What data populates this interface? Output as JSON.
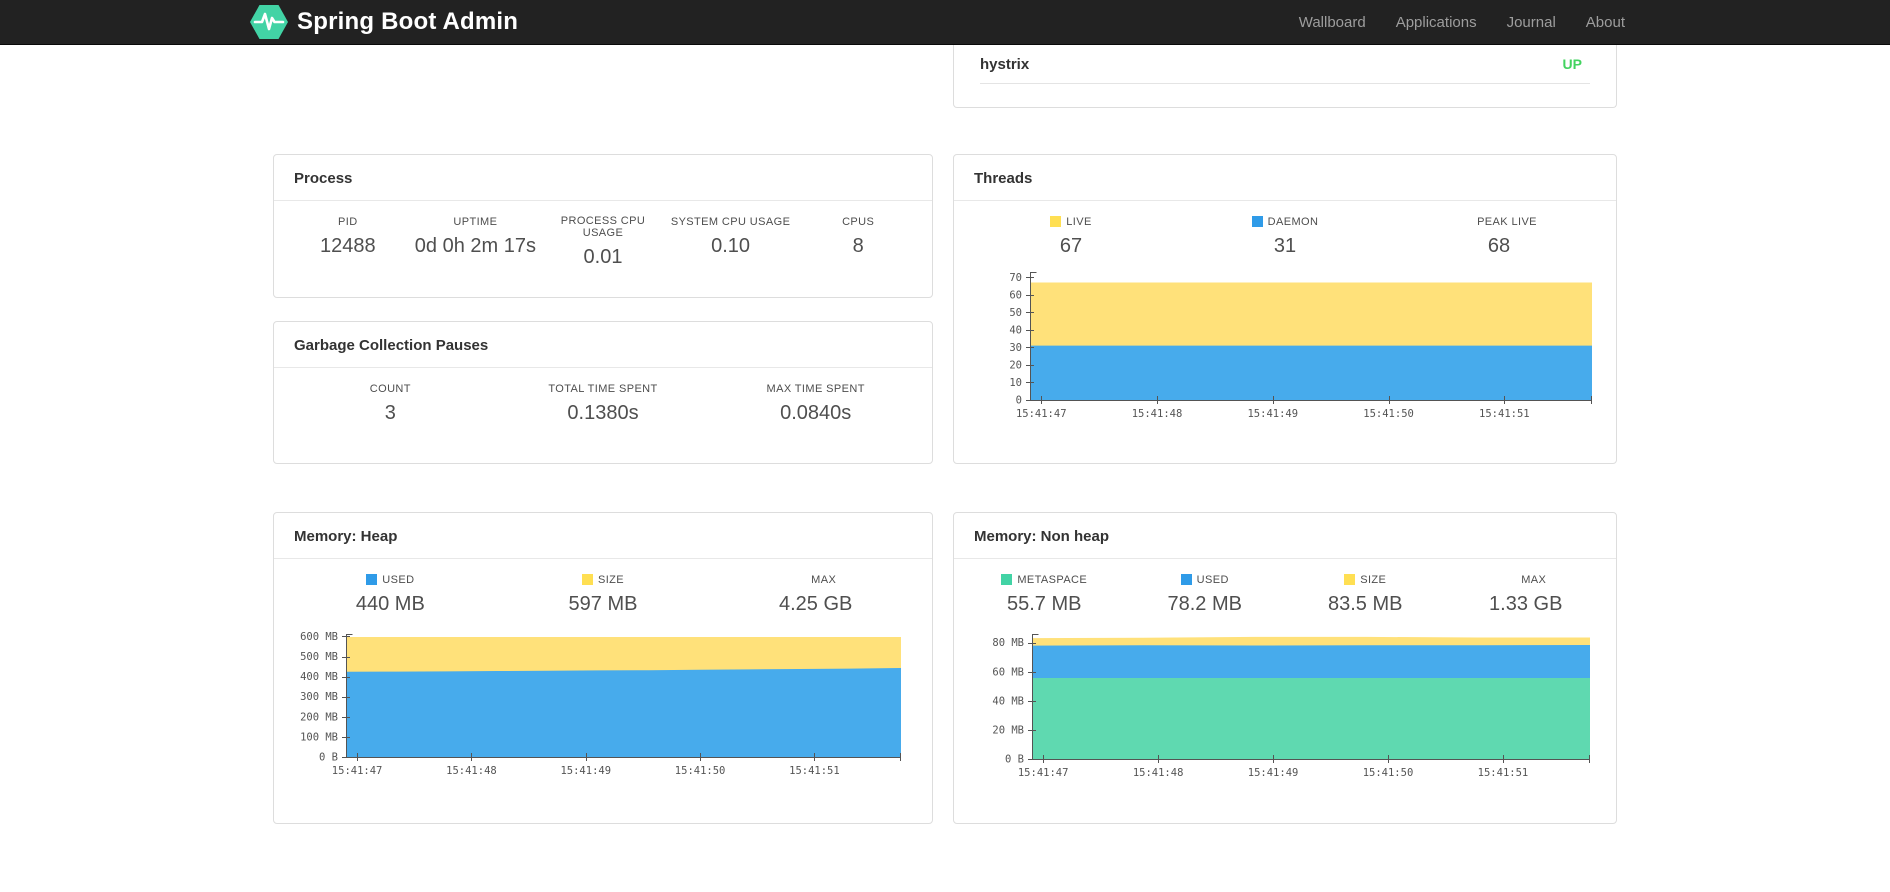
{
  "navbar": {
    "brand": "Spring Boot Admin",
    "brand_color": "#42d3a5",
    "links": [
      {
        "label": "Wallboard"
      },
      {
        "label": "Applications"
      },
      {
        "label": "Journal"
      },
      {
        "label": "About"
      }
    ]
  },
  "health_panel": {
    "name": "hystrix",
    "status": "UP",
    "status_color": "#42d35f"
  },
  "panels": {
    "process": {
      "title": "Process",
      "metrics": [
        {
          "label": "PID",
          "value": "12488"
        },
        {
          "label": "UPTIME",
          "value": "0d 0h 2m 17s"
        },
        {
          "label": "PROCESS CPU USAGE",
          "value": "0.01"
        },
        {
          "label": "SYSTEM CPU USAGE",
          "value": "0.10"
        },
        {
          "label": "CPUS",
          "value": "8"
        }
      ]
    },
    "gc": {
      "title": "Garbage Collection Pauses",
      "metrics": [
        {
          "label": "COUNT",
          "value": "3"
        },
        {
          "label": "TOTAL TIME SPENT",
          "value": "0.1380s"
        },
        {
          "label": "MAX TIME SPENT",
          "value": "0.0840s"
        }
      ]
    },
    "threads": {
      "title": "Threads",
      "legend": [
        {
          "label": "LIVE",
          "value": "67",
          "swatch": "#ffdf52"
        },
        {
          "label": "DAEMON",
          "value": "31",
          "swatch": "#2f9be8"
        },
        {
          "label": "PEAK LIVE",
          "value": "68",
          "swatch": null
        }
      ]
    },
    "heap": {
      "title": "Memory: Heap",
      "legend": [
        {
          "label": "USED",
          "value": "440 MB",
          "swatch": "#2f9be8"
        },
        {
          "label": "SIZE",
          "value": "597 MB",
          "swatch": "#ffdf52"
        },
        {
          "label": "MAX",
          "value": "4.25 GB",
          "swatch": null
        }
      ]
    },
    "nonheap": {
      "title": "Memory: Non heap",
      "legend": [
        {
          "label": "METASPACE",
          "value": "55.7 MB",
          "swatch": "#42d3a5"
        },
        {
          "label": "USED",
          "value": "78.2 MB",
          "swatch": "#2f9be8"
        },
        {
          "label": "SIZE",
          "value": "83.5 MB",
          "swatch": "#ffdf52"
        },
        {
          "label": "MAX",
          "value": "1.33 GB",
          "swatch": null
        }
      ]
    }
  },
  "chart_data": [
    {
      "id": "threads",
      "type": "area",
      "stacked": true,
      "title": "Threads",
      "legend_position": "top",
      "grid": false,
      "x_tick_labels": [
        "15:41:47",
        "15:41:48",
        "15:41:49",
        "15:41:50",
        "15:41:51"
      ],
      "y_domain_max": 73,
      "y_ticks": {
        "values": [
          0,
          10,
          20,
          30,
          40,
          50,
          60,
          70
        ],
        "labels": [
          "0",
          "10",
          "20",
          "30",
          "40",
          "50",
          "60",
          "70"
        ]
      },
      "series": [
        {
          "name": "daemon",
          "color": "#47abec",
          "values": [
            31,
            31
          ]
        },
        {
          "name": "live",
          "color": "#ffe17a",
          "values": [
            67,
            67
          ]
        }
      ]
    },
    {
      "id": "heap",
      "type": "area",
      "stacked": true,
      "title": "Memory: Heap",
      "legend_position": "top",
      "grid": false,
      "x_tick_labels": [
        "15:41:47",
        "15:41:48",
        "15:41:49",
        "15:41:50",
        "15:41:51"
      ],
      "y_domain_max": 612,
      "y_ticks": {
        "values": [
          0,
          100,
          200,
          300,
          400,
          500,
          600
        ],
        "labels": [
          "0 B",
          "100 MB",
          "200 MB",
          "300 MB",
          "400 MB",
          "500 MB",
          "600 MB"
        ]
      },
      "series": [
        {
          "name": "used",
          "color": "#47abec",
          "values": [
            424,
            425,
            426,
            428,
            429,
            431,
            432,
            434,
            436,
            438,
            440,
            443
          ]
        },
        {
          "name": "size",
          "color": "#ffe17a",
          "values": [
            597,
            597
          ]
        }
      ]
    },
    {
      "id": "nonheap",
      "type": "area",
      "stacked": true,
      "title": "Memory: Non heap",
      "legend_position": "top",
      "grid": false,
      "x_tick_labels": [
        "15:41:47",
        "15:41:48",
        "15:41:49",
        "15:41:50",
        "15:41:51"
      ],
      "y_domain_max": 86,
      "y_ticks": {
        "values": [
          0,
          20,
          40,
          60,
          80
        ],
        "labels": [
          "0 B",
          "20 MB",
          "40 MB",
          "60 MB",
          "80 MB"
        ]
      },
      "series": [
        {
          "name": "metaspace",
          "color": "#5fd9b0",
          "values": [
            55.7,
            55.7
          ]
        },
        {
          "name": "used",
          "color": "#47abec",
          "values": [
            78.0,
            78.2,
            78.1,
            78.3,
            78.2,
            78.4
          ]
        },
        {
          "name": "size",
          "color": "#ffe17a",
          "values": [
            83.2,
            83.4,
            84.0,
            84.0,
            83.6,
            83.6
          ]
        }
      ]
    }
  ]
}
